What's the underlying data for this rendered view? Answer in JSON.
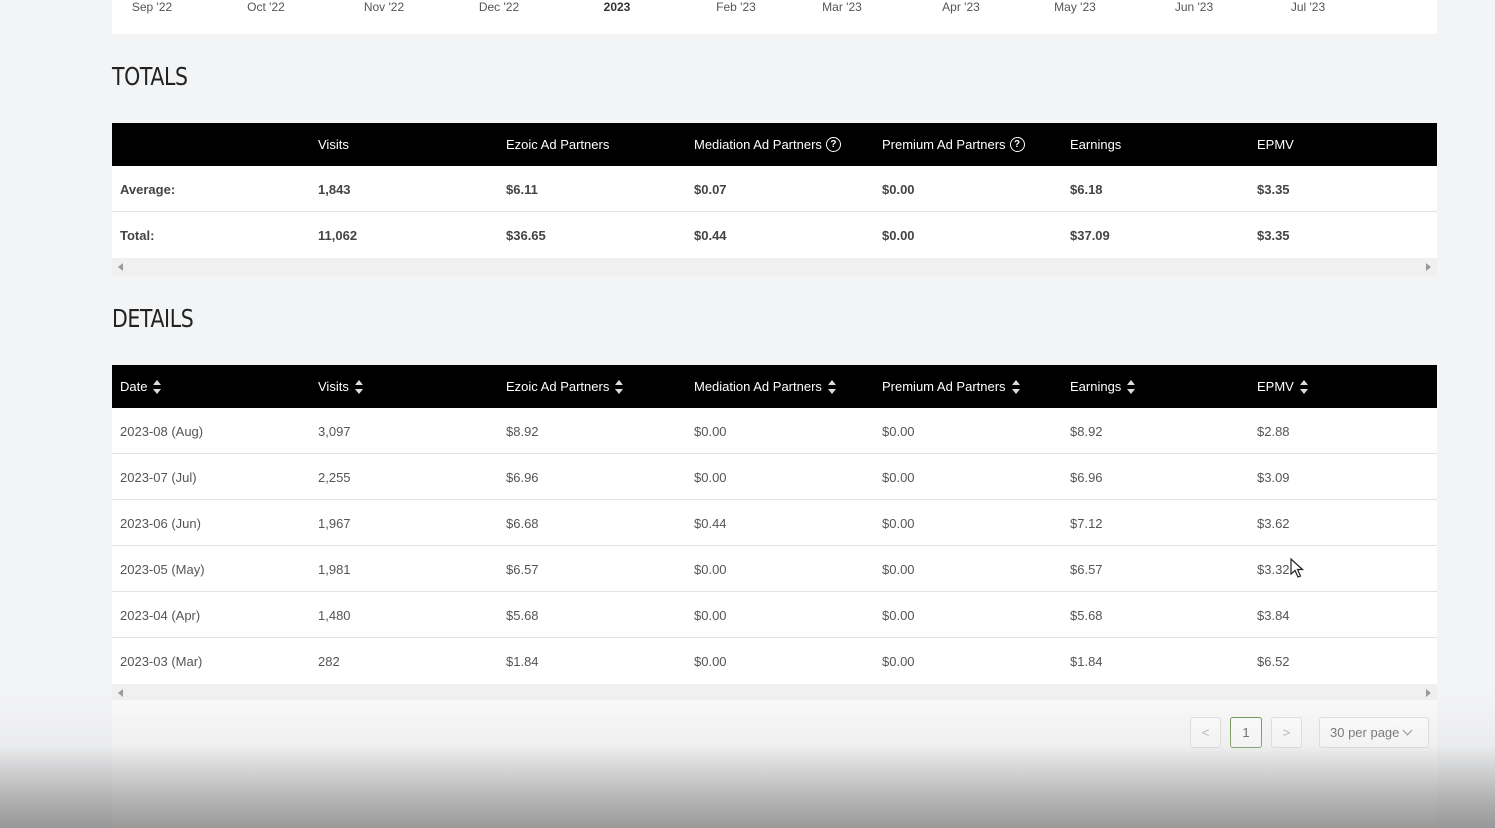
{
  "axis": {
    "labels": [
      {
        "text": "Sep '22",
        "bold": false
      },
      {
        "text": "Oct '22",
        "bold": false
      },
      {
        "text": "Nov '22",
        "bold": false
      },
      {
        "text": "Dec '22",
        "bold": false
      },
      {
        "text": "2023",
        "bold": true
      },
      {
        "text": "Feb '23",
        "bold": false
      },
      {
        "text": "Mar '23",
        "bold": false
      },
      {
        "text": "Apr '23",
        "bold": false
      },
      {
        "text": "May '23",
        "bold": false
      },
      {
        "text": "Jun '23",
        "bold": false
      },
      {
        "text": "Jul '23",
        "bold": false
      }
    ]
  },
  "totals": {
    "title": "TOTALS",
    "columns": [
      "",
      "Visits",
      "Ezoic Ad Partners",
      "Mediation Ad Partners",
      "Premium Ad Partners",
      "Earnings",
      "EPMV"
    ],
    "rows": [
      [
        "Average:",
        "1,843",
        "$6.11",
        "$0.07",
        "$0.00",
        "$6.18",
        "$3.35"
      ],
      [
        "Total:",
        "11,062",
        "$36.65",
        "$0.44",
        "$0.00",
        "$37.09",
        "$3.35"
      ]
    ]
  },
  "details": {
    "title": "DETAILS",
    "columns": [
      "Date",
      "Visits",
      "Ezoic Ad Partners",
      "Mediation Ad Partners",
      "Premium Ad Partners",
      "Earnings",
      "EPMV"
    ],
    "rows": [
      [
        "2023-08 (Aug)",
        "3,097",
        "$8.92",
        "$0.00",
        "$0.00",
        "$8.92",
        "$2.88"
      ],
      [
        "2023-07 (Jul)",
        "2,255",
        "$6.96",
        "$0.00",
        "$0.00",
        "$6.96",
        "$3.09"
      ],
      [
        "2023-06 (Jun)",
        "1,967",
        "$6.68",
        "$0.44",
        "$0.00",
        "$7.12",
        "$3.62"
      ],
      [
        "2023-05 (May)",
        "1,981",
        "$6.57",
        "$0.00",
        "$0.00",
        "$6.57",
        "$3.32"
      ],
      [
        "2023-04 (Apr)",
        "1,480",
        "$5.68",
        "$0.00",
        "$0.00",
        "$5.68",
        "$3.84"
      ],
      [
        "2023-03 (Mar)",
        "282",
        "$1.84",
        "$0.00",
        "$0.00",
        "$1.84",
        "$6.52"
      ]
    ]
  },
  "pagination": {
    "prev": "<",
    "current_page": "1",
    "next": ">",
    "per_page": "30 per page"
  },
  "colors": {
    "header_bg": "#000000",
    "accent": "#5a8a3a"
  }
}
